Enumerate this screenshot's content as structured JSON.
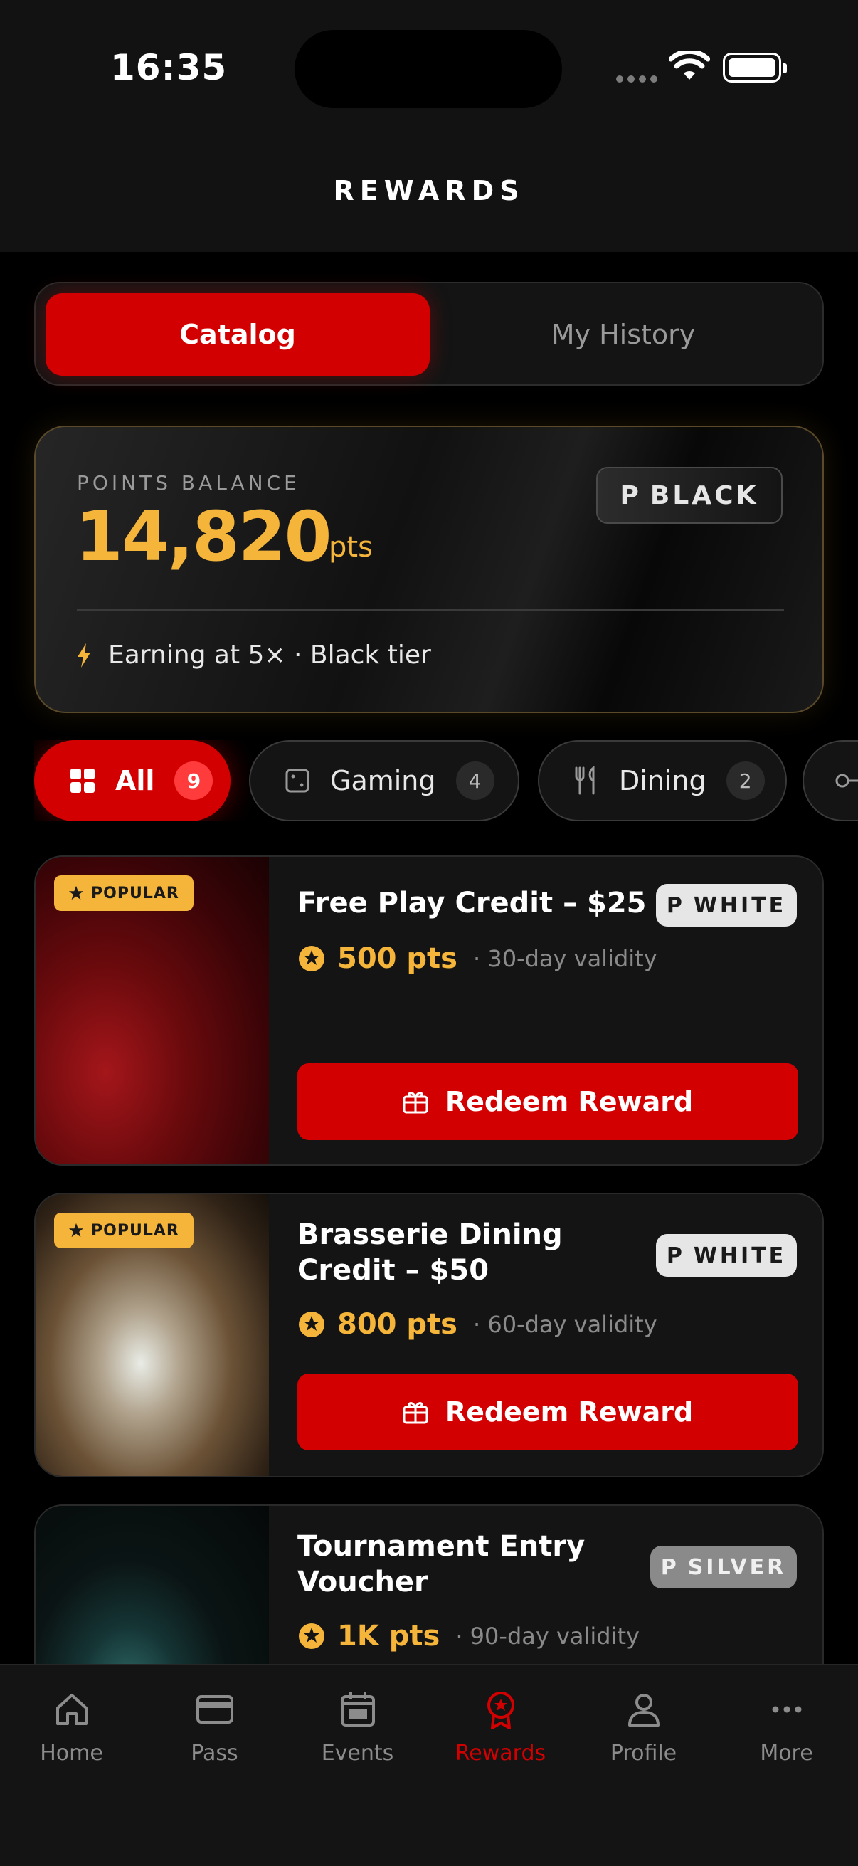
{
  "status": {
    "time": "16:35"
  },
  "header": {
    "title": "REWARDS"
  },
  "segments": {
    "catalog": "Catalog",
    "history": "My History"
  },
  "balance": {
    "label": "POINTS BALANCE",
    "points": "14,820",
    "unit": "pts",
    "tier_prefix": "P",
    "tier": "BLACK",
    "earn_text": "Earning at 5× · Black tier",
    "earn_icon": "lightning-icon"
  },
  "filters": [
    {
      "label": "All",
      "count": "9",
      "icon": "grid-icon",
      "active": true
    },
    {
      "label": "Gaming",
      "count": "4",
      "icon": "dice-icon",
      "active": false
    },
    {
      "label": "Dining",
      "count": "2",
      "icon": "fork-knife-icon",
      "active": false
    },
    {
      "label": "",
      "count": "",
      "icon": "key-icon",
      "active": false
    }
  ],
  "rewards": [
    {
      "badge": "POPULAR",
      "title": "Free Play Credit – $25",
      "tier_prefix": "P",
      "tier": "WHITE",
      "points": "500 pts",
      "validity": "· 30-day validity",
      "cta": "Redeem Reward"
    },
    {
      "badge": "POPULAR",
      "title_line1": "Brasserie Dining",
      "title_line2": "Credit – $50",
      "tier_prefix": "P",
      "tier": "WHITE",
      "points": "800 pts",
      "validity": "· 60-day validity",
      "cta": "Redeem Reward"
    },
    {
      "title_line1": "Tournament Entry",
      "title_line2": "Voucher",
      "tier_prefix": "P",
      "tier": "SILVER",
      "points": "1K pts",
      "validity": "· 90-day validity"
    }
  ],
  "tabbar": {
    "items": [
      {
        "label": "Home",
        "icon": "home-icon"
      },
      {
        "label": "Pass",
        "icon": "card-icon"
      },
      {
        "label": "Events",
        "icon": "calendar-icon"
      },
      {
        "label": "Rewards",
        "icon": "award-icon",
        "active": true
      },
      {
        "label": "Profile",
        "icon": "person-icon"
      },
      {
        "label": "More",
        "icon": "more-icon"
      }
    ]
  },
  "colors": {
    "accent": "#d20000",
    "gold": "#f5b53a",
    "background": "#000000"
  }
}
